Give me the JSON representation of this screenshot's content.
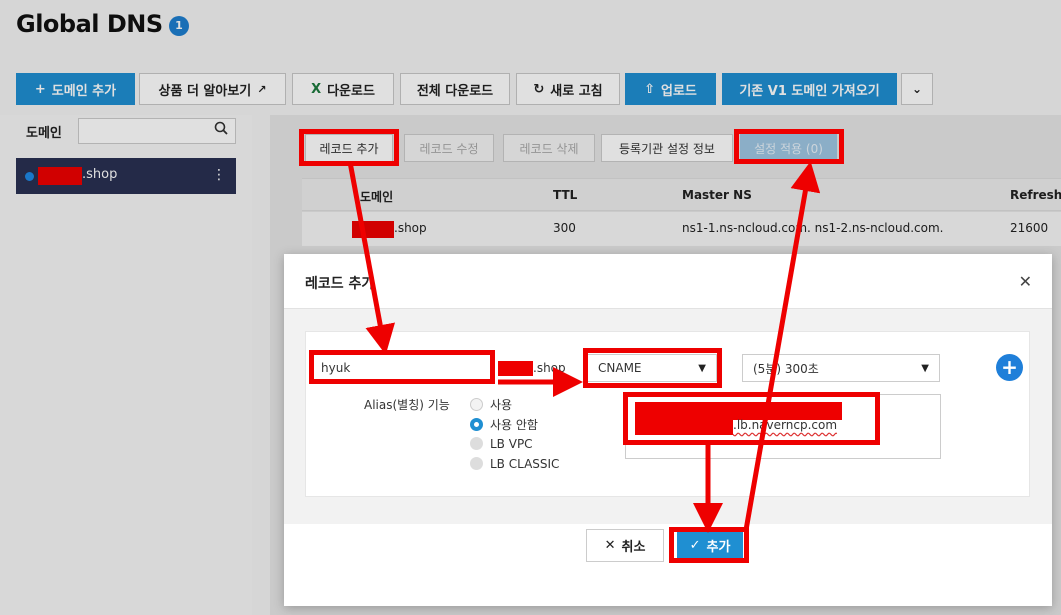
{
  "page": {
    "title": "Global DNS",
    "badge": "1"
  },
  "toolbar": {
    "add_domain": "도메인 추가",
    "learn_more": "상품 더 알아보기",
    "download": "다운로드",
    "download_all": "전체 다운로드",
    "refresh": "새로 고침",
    "upload": "업로드",
    "import_v1": "기존 V1 도메인 가져오기"
  },
  "sidebar": {
    "label": "도메인",
    "search_placeholder": "",
    "selected_domain": ".shop"
  },
  "record_toolbar": {
    "add_record": "레코드 추가",
    "edit_record": "레코드 수정",
    "delete_record": "레코드 삭제",
    "registrar_info": "등록기관 설정 정보",
    "apply_settings": "설정 적용 (0)"
  },
  "table": {
    "headers": [
      "도메인",
      "TTL",
      "Master NS",
      "Refresh"
    ],
    "rows": [
      {
        "domain": ".shop",
        "ttl": "300",
        "master_ns": "ns1-1.ns-ncloud.com. ns1-2.ns-ncloud.com.",
        "refresh": "21600"
      }
    ]
  },
  "modal": {
    "title": "레코드 추가",
    "host_value": "hyuk",
    "host_suffix": ".shop",
    "record_type": "CNAME",
    "ttl": "(5분) 300초",
    "alias_label": "Alias(별칭) 기능",
    "alias_options": [
      "사용",
      "사용 안함",
      "LB VPC",
      "LB CLASSIC"
    ],
    "target_value": ".lb.naverncp.com",
    "cancel": "취소",
    "submit": "추가"
  }
}
